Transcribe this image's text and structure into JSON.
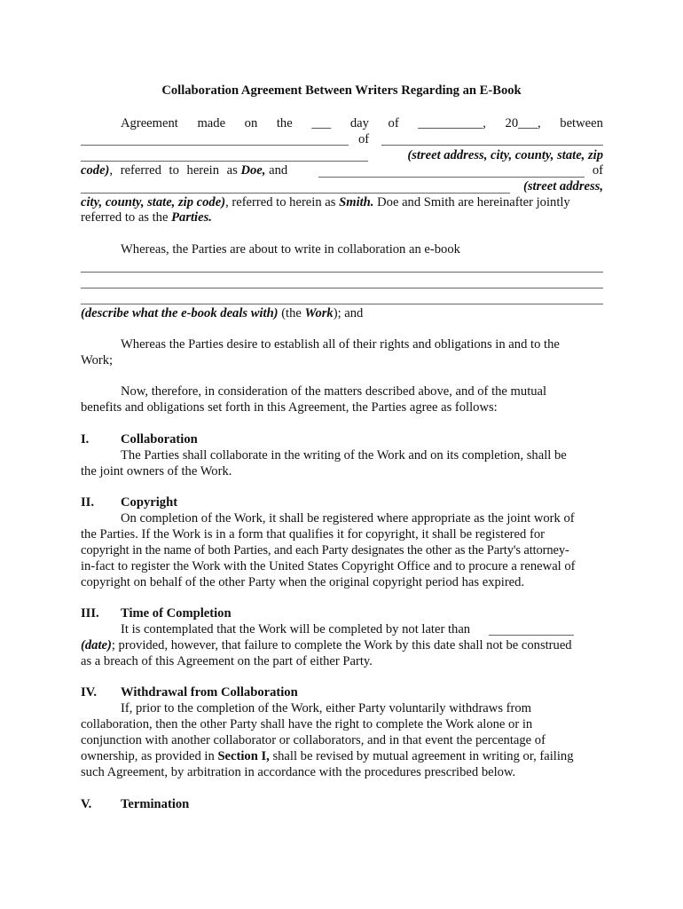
{
  "document": {
    "title": "Collaboration Agreement Between Writers Regarding an E-Book",
    "preamble": {
      "l1": [
        "Agreement",
        "made",
        "on",
        "the",
        "___",
        "day",
        "of",
        "__________,",
        "20___,",
        "between"
      ],
      "l2_of": "of",
      "l3_italic": "(street address, city, county, state, zip",
      "l4_italic": "code)",
      "l4_text": ", referred to herein as",
      "l4_doe": "Doe,",
      "l4_and": "and",
      "l4_of": "of",
      "l5_italic": "(street address,",
      "l6_italic": "city, county, state, zip code)",
      "l6_text": ", referred to herein as",
      "l6_smith": "Smith.",
      "l6_rest": "Doe and Smith are hereinafter jointly",
      "l7_text": "referred to as the",
      "l7_parties": "Parties."
    },
    "whereas1": {
      "text": "Whereas, the Parties are about to write in collaboration an e-book",
      "describe_italic": "(describe what the e-book deals with)",
      "describe_text1": " (the ",
      "describe_work": "Work",
      "describe_text2": "); and"
    },
    "whereas2": {
      "l1": "Whereas the Parties desire to establish all of their rights and obligations in and to the",
      "l2": "Work;"
    },
    "now_therefore": {
      "l1": "Now, therefore, in consideration of the matters described above, and of the mutual",
      "l2": "benefits and obligations set forth in this Agreement, the Parties agree as follows:"
    },
    "sections": [
      {
        "num": "I.",
        "heading": "Collaboration",
        "lines": [
          "The Parties shall collaborate in the writing of the Work and on its completion, shall be",
          "the joint owners of the Work."
        ]
      },
      {
        "num": "II.",
        "heading": "Copyright",
        "lines": [
          "On completion of the Work, it shall be registered where appropriate as the joint work of",
          "the Parties. If the Work is in a form that qualifies it for copyright, it shall be registered for",
          "copyright in the name of both Parties, and each Party designates the other as the Party's attorney-",
          "in-fact to register the Work with the United States Copyright Office and to procure a renewal of",
          "copyright on behalf of the other Party when the original copyright period has expired."
        ]
      },
      {
        "num": "III.",
        "heading": "Time of Completion",
        "l1": "It is contemplated that the Work will be completed by not later than",
        "l2_italic": "(date)",
        "l2_text": "; provided, however, that failure to complete the Work by this date shall not be construed",
        "l3": "as a breach of this Agreement on the part of either Party."
      },
      {
        "num": "IV.",
        "heading": "Withdrawal from Collaboration",
        "l1": "If, prior to the completion of the Work, either Party voluntarily withdraws from",
        "l2": "collaboration, then the other Party shall have the right to complete the Work alone or in",
        "l3": "conjunction with another collaborator or collaborators, and in that event the percentage of",
        "l4_a": "ownership, as provided in ",
        "l4_bold": "Section I,",
        "l4_b": " shall be revised by mutual agreement in writing or, failing",
        "l5": "such Agreement, by arbitration in accordance with the procedures prescribed below."
      },
      {
        "num": "V.",
        "heading": "Termination"
      }
    ]
  }
}
